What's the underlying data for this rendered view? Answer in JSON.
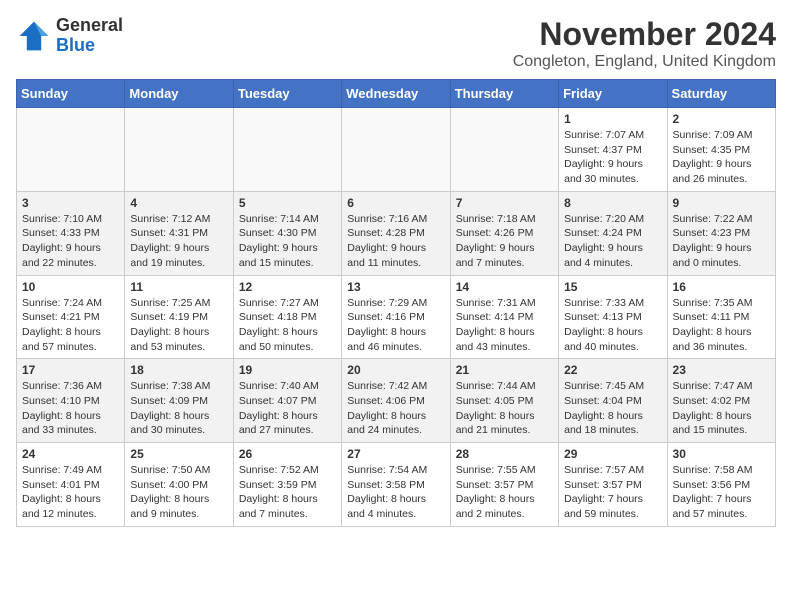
{
  "header": {
    "logo_general": "General",
    "logo_blue": "Blue",
    "month_title": "November 2024",
    "location": "Congleton, England, United Kingdom"
  },
  "weekdays": [
    "Sunday",
    "Monday",
    "Tuesday",
    "Wednesday",
    "Thursday",
    "Friday",
    "Saturday"
  ],
  "weeks": [
    [
      {
        "day": "",
        "info": ""
      },
      {
        "day": "",
        "info": ""
      },
      {
        "day": "",
        "info": ""
      },
      {
        "day": "",
        "info": ""
      },
      {
        "day": "",
        "info": ""
      },
      {
        "day": "1",
        "info": "Sunrise: 7:07 AM\nSunset: 4:37 PM\nDaylight: 9 hours and 30 minutes."
      },
      {
        "day": "2",
        "info": "Sunrise: 7:09 AM\nSunset: 4:35 PM\nDaylight: 9 hours and 26 minutes."
      }
    ],
    [
      {
        "day": "3",
        "info": "Sunrise: 7:10 AM\nSunset: 4:33 PM\nDaylight: 9 hours and 22 minutes."
      },
      {
        "day": "4",
        "info": "Sunrise: 7:12 AM\nSunset: 4:31 PM\nDaylight: 9 hours and 19 minutes."
      },
      {
        "day": "5",
        "info": "Sunrise: 7:14 AM\nSunset: 4:30 PM\nDaylight: 9 hours and 15 minutes."
      },
      {
        "day": "6",
        "info": "Sunrise: 7:16 AM\nSunset: 4:28 PM\nDaylight: 9 hours and 11 minutes."
      },
      {
        "day": "7",
        "info": "Sunrise: 7:18 AM\nSunset: 4:26 PM\nDaylight: 9 hours and 7 minutes."
      },
      {
        "day": "8",
        "info": "Sunrise: 7:20 AM\nSunset: 4:24 PM\nDaylight: 9 hours and 4 minutes."
      },
      {
        "day": "9",
        "info": "Sunrise: 7:22 AM\nSunset: 4:23 PM\nDaylight: 9 hours and 0 minutes."
      }
    ],
    [
      {
        "day": "10",
        "info": "Sunrise: 7:24 AM\nSunset: 4:21 PM\nDaylight: 8 hours and 57 minutes."
      },
      {
        "day": "11",
        "info": "Sunrise: 7:25 AM\nSunset: 4:19 PM\nDaylight: 8 hours and 53 minutes."
      },
      {
        "day": "12",
        "info": "Sunrise: 7:27 AM\nSunset: 4:18 PM\nDaylight: 8 hours and 50 minutes."
      },
      {
        "day": "13",
        "info": "Sunrise: 7:29 AM\nSunset: 4:16 PM\nDaylight: 8 hours and 46 minutes."
      },
      {
        "day": "14",
        "info": "Sunrise: 7:31 AM\nSunset: 4:14 PM\nDaylight: 8 hours and 43 minutes."
      },
      {
        "day": "15",
        "info": "Sunrise: 7:33 AM\nSunset: 4:13 PM\nDaylight: 8 hours and 40 minutes."
      },
      {
        "day": "16",
        "info": "Sunrise: 7:35 AM\nSunset: 4:11 PM\nDaylight: 8 hours and 36 minutes."
      }
    ],
    [
      {
        "day": "17",
        "info": "Sunrise: 7:36 AM\nSunset: 4:10 PM\nDaylight: 8 hours and 33 minutes."
      },
      {
        "day": "18",
        "info": "Sunrise: 7:38 AM\nSunset: 4:09 PM\nDaylight: 8 hours and 30 minutes."
      },
      {
        "day": "19",
        "info": "Sunrise: 7:40 AM\nSunset: 4:07 PM\nDaylight: 8 hours and 27 minutes."
      },
      {
        "day": "20",
        "info": "Sunrise: 7:42 AM\nSunset: 4:06 PM\nDaylight: 8 hours and 24 minutes."
      },
      {
        "day": "21",
        "info": "Sunrise: 7:44 AM\nSunset: 4:05 PM\nDaylight: 8 hours and 21 minutes."
      },
      {
        "day": "22",
        "info": "Sunrise: 7:45 AM\nSunset: 4:04 PM\nDaylight: 8 hours and 18 minutes."
      },
      {
        "day": "23",
        "info": "Sunrise: 7:47 AM\nSunset: 4:02 PM\nDaylight: 8 hours and 15 minutes."
      }
    ],
    [
      {
        "day": "24",
        "info": "Sunrise: 7:49 AM\nSunset: 4:01 PM\nDaylight: 8 hours and 12 minutes."
      },
      {
        "day": "25",
        "info": "Sunrise: 7:50 AM\nSunset: 4:00 PM\nDaylight: 8 hours and 9 minutes."
      },
      {
        "day": "26",
        "info": "Sunrise: 7:52 AM\nSunset: 3:59 PM\nDaylight: 8 hours and 7 minutes."
      },
      {
        "day": "27",
        "info": "Sunrise: 7:54 AM\nSunset: 3:58 PM\nDaylight: 8 hours and 4 minutes."
      },
      {
        "day": "28",
        "info": "Sunrise: 7:55 AM\nSunset: 3:57 PM\nDaylight: 8 hours and 2 minutes."
      },
      {
        "day": "29",
        "info": "Sunrise: 7:57 AM\nSunset: 3:57 PM\nDaylight: 7 hours and 59 minutes."
      },
      {
        "day": "30",
        "info": "Sunrise: 7:58 AM\nSunset: 3:56 PM\nDaylight: 7 hours and 57 minutes."
      }
    ]
  ]
}
